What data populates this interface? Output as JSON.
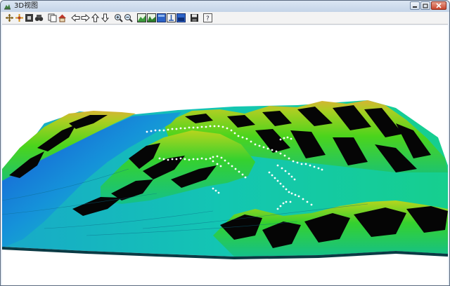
{
  "window": {
    "title": "3D视图",
    "app_icon": "terrain-app-icon",
    "controls": [
      {
        "name": "minimize-button",
        "icon": "minimize-icon"
      },
      {
        "name": "maximize-button",
        "icon": "maximize-icon"
      },
      {
        "name": "close-button",
        "icon": "close-icon"
      }
    ]
  },
  "toolbar": {
    "groups": [
      [
        "pan-icon",
        "move-icon",
        "select-icon",
        "binoculars-icon"
      ],
      [
        "copy-icon",
        "home-icon"
      ],
      [
        "arrow-left-icon",
        "arrow-right-icon",
        "arrow-up-icon",
        "arrow-down-icon"
      ],
      [
        "zoom-in-icon",
        "zoom-out-icon"
      ],
      [
        "terrain-view-1-icon",
        "terrain-view-2-icon",
        "terrain-view-3-icon",
        "terrain-view-4-icon",
        "terrain-view-5-icon"
      ],
      [
        "save-icon"
      ],
      [
        "help-icon"
      ]
    ]
  },
  "colors": {
    "terrain_low": "#1a4fd6",
    "terrain_mid": "#17c3a0",
    "terrain_high": "#3ad21c",
    "terrain_peak": "#d7b82f",
    "shadow": "#050505",
    "track_points": "#ffffff"
  }
}
